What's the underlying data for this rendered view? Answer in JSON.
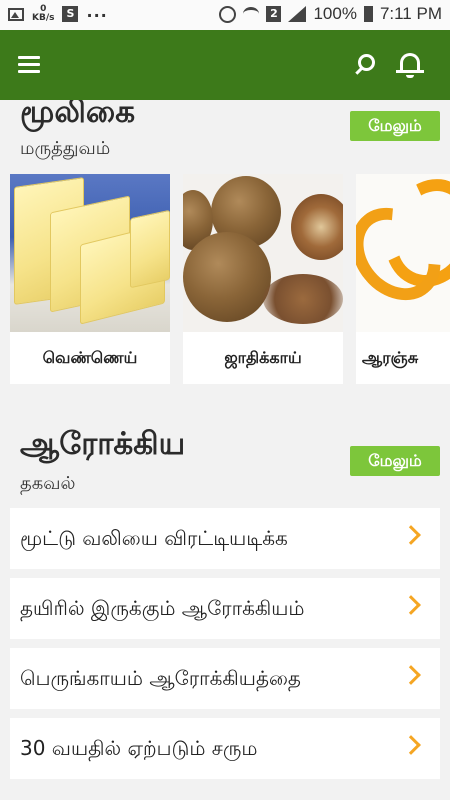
{
  "status_bar": {
    "kb_value": "0",
    "kb_unit": "KB/s",
    "s_badge": "S",
    "dots": "...",
    "sim_badge": "2",
    "battery": "100%",
    "time": "7:11 PM"
  },
  "app_bar": {
    "menu_icon": "hamburger-menu",
    "search_icon": "search",
    "bell_icon": "bell",
    "primary_color": "#3d7a1a"
  },
  "herbal_section": {
    "title": "மூலிகை",
    "subtitle": "மருத்துவம்",
    "more_label": "மேலும்",
    "cards": [
      {
        "label": "வெண்ணெய்"
      },
      {
        "label": "ஜாதிக்காய்"
      },
      {
        "label": "ஆரஞ்சு"
      }
    ]
  },
  "health_section": {
    "title": "ஆரோக்கிய",
    "subtitle": "தகவல்",
    "more_label": "மேலும்",
    "items": [
      {
        "label": "மூட்டு வலியை விரட்டியடிக்க"
      },
      {
        "label": "தயிரில் இருக்கும் ஆரோக்கியம்"
      },
      {
        "label": "பெருங்காயம் ஆரோக்கியத்தை"
      },
      {
        "label": "30 வயதில் ஏற்படும் சரும"
      }
    ]
  },
  "colors": {
    "accent_button": "#7dc63b",
    "chevron": "#f5a623"
  }
}
